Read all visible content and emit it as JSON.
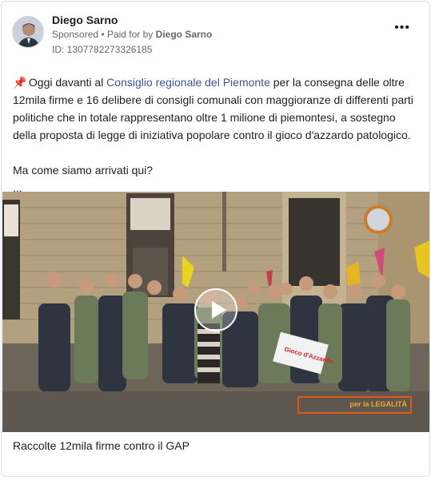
{
  "post": {
    "author": "Diego Sarno",
    "sponsored": "Sponsored",
    "paid_for_by_label": "Paid for by",
    "paid_for_by": "Diego Sarno",
    "ad_id": "ID: 1307782273326185",
    "more_icon": "more-horizontal-icon",
    "text": {
      "pin_icon": "📌",
      "part1": " Oggi davanti al ",
      "link": "Consiglio regionale del Piemonte",
      "part2": " per la consegna delle oltre 12mila firme e 16 delibere di consigli comunali con maggioranze di differenti parti politiche che in totale rappresentano oltre 1 milione di piemontesi, a sostegno della proposta di legge di iniziativa popolare contro il gioco d'azzardo patologico.",
      "line2": "Ma come siamo arrivati qui?",
      "ellipsis": "..."
    },
    "media": {
      "overlay_label": "per la LEGALITÀ",
      "sign_text": "Gioco d'Azzardo",
      "play_icon": "play-icon"
    },
    "caption": "Raccolte 12mila firme contro il GAP"
  }
}
